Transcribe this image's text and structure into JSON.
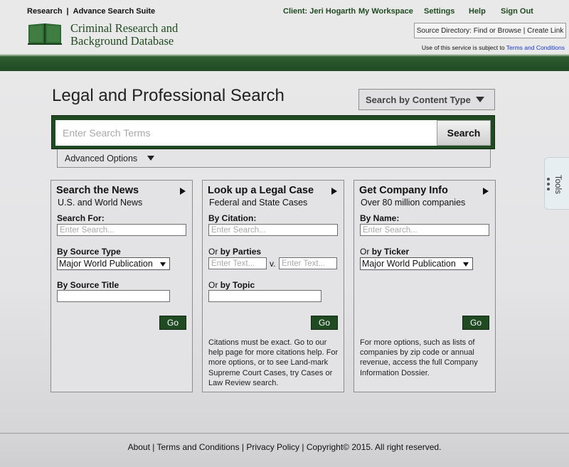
{
  "header": {
    "research": "Research",
    "separator": "|",
    "suite": "Advance Search Suite",
    "client": "Client: Jeri Hogarth",
    "workspace": "My Workspace",
    "settings": "Settings",
    "help": "Help",
    "sign_out": "Sign Out",
    "logo_line1": "Criminal Research and",
    "logo_line2": "Background Database",
    "source_directory": "Source Directory: Find or Browse | Create Link",
    "terms_note": "Use of this service is subject to",
    "terms_link": "Terms and Conditions"
  },
  "main": {
    "title": "Legal and Professional Search",
    "content_type": "Search by Content Type",
    "search_placeholder": "Enter Search Terms",
    "search_button": "Search",
    "advanced_options": "Advanced Options"
  },
  "panels": {
    "news": {
      "title": "Search the  News",
      "subtitle": "U.S. and World News",
      "search_for_label": "Search For:",
      "search_placeholder": "Enter Search...",
      "source_type_label": "By Source Type",
      "source_type_value": "Major World Publication",
      "source_title_label": "By Source Title",
      "go": "Go"
    },
    "legal": {
      "title": "Look up a Legal Case",
      "subtitle": "Federal and State Cases",
      "citation_label": "By Citation:",
      "citation_placeholder": "Enter Search...",
      "or": "Or",
      "parties_label": "by Parties",
      "parties_placeholder": "Enter Text...",
      "versus": "v.",
      "topic_label": "by Topic",
      "go": "Go",
      "note": "Citations must be exact. Go to our help page for more citations help. For more options, or to see Land-mark Supreme Court Cases, try Cases or Law Review search."
    },
    "company": {
      "title": "Get Company Info",
      "subtitle": "Over 80 million companies",
      "name_label": "By Name:",
      "name_placeholder": "Enter Search...",
      "or": "Or",
      "ticker_label": "by Ticker",
      "ticker_value": "Major World Publication",
      "go": "Go",
      "note": "For more options, such as lists of companies by zip code or annual revenue, access the full Company Information Dossier."
    }
  },
  "tools": {
    "label": "Tools"
  },
  "footer": {
    "text": "About | Terms and Conditions | Privacy Policy | Copyright© 2015. All right reserved."
  }
}
